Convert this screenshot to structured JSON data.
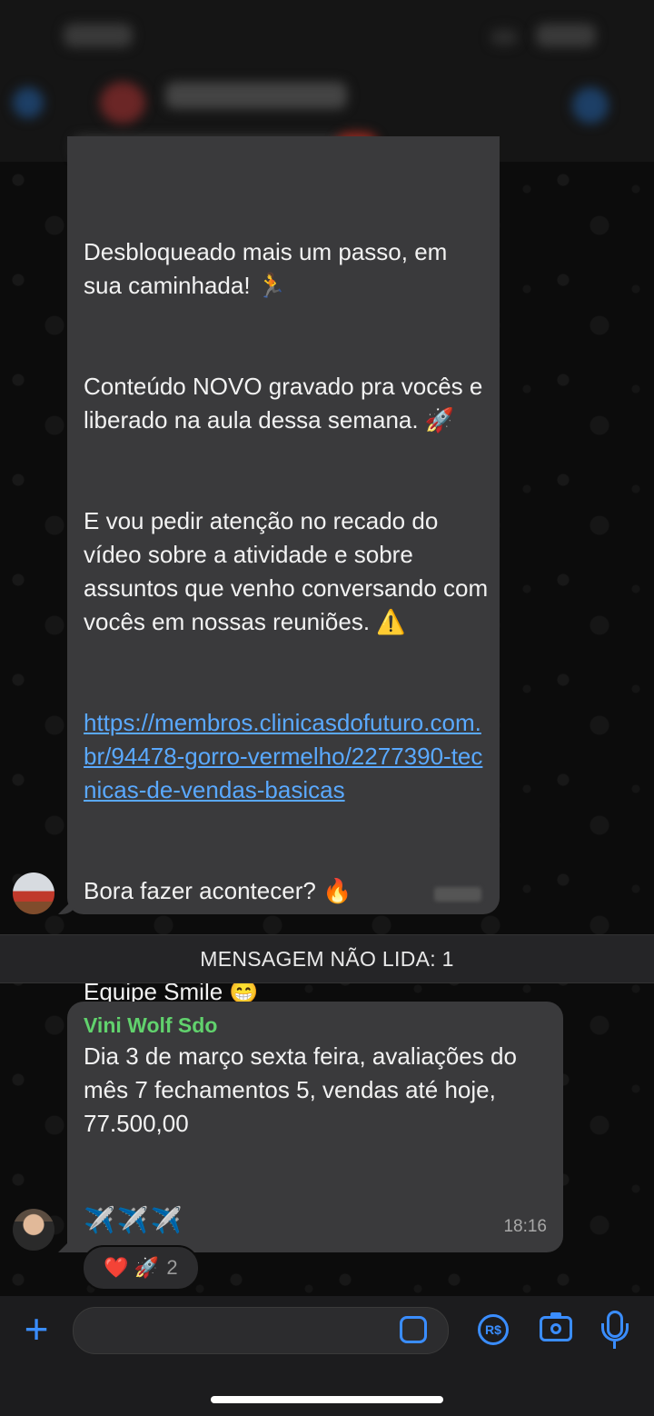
{
  "message1": {
    "paragraphs": [
      "Desbloqueado mais um passo, em sua caminhada! 🏃",
      "Conteúdo NOVO gravado pra vocês e liberado na aula dessa semana. 🚀",
      "E vou pedir atenção no recado do vídeo sobre a atividade e sobre assuntos que venho conversando com vocês em nossas reuniões. ⚠️"
    ],
    "link": "https://membros.clinicasdofuturo.com.br/94478-gorro-vermelho/2277390-tecnicas-de-vendas-basicas",
    "cta": "Bora fazer acontecer? 🔥",
    "signature": "Equipe Smile 😁"
  },
  "unread_banner": "MENSAGEM NÃO LIDA: 1",
  "message2": {
    "sender": "Vini Wolf Sdo",
    "sender_color": "#61d26d",
    "text": "Dia 3 de março sexta feira, avaliações do mês 7 fechamentos 5, vendas até hoje, 77.500,00",
    "emojis": "✈️✈️✈️",
    "time": "18:16",
    "reactions": {
      "emojis": "❤️ 🚀",
      "count": "2"
    }
  },
  "composer": {
    "currency_icon_label": "R$",
    "accent": "#3a8dff"
  }
}
